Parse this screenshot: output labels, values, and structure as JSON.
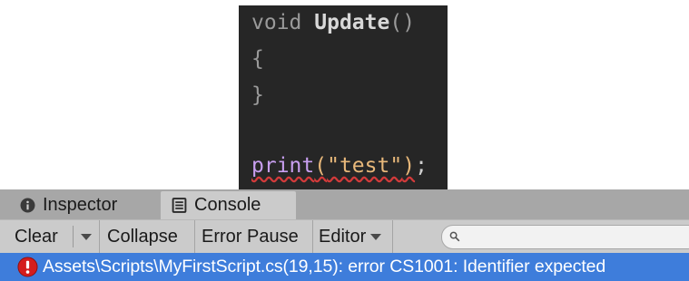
{
  "code": {
    "line1": {
      "keyword": "void",
      "name": "Update",
      "parens": "()"
    },
    "line2": "{",
    "line3": "}",
    "line5": {
      "call": "print",
      "open": "(",
      "string": "\"test\"",
      "close": ")",
      "semi": ";"
    }
  },
  "tabs": [
    {
      "label": "Inspector",
      "icon": "info-icon"
    },
    {
      "label": "Console",
      "icon": "console-icon",
      "active": true
    }
  ],
  "toolbar": {
    "clear_label": "Clear",
    "collapse_label": "Collapse",
    "error_pause_label": "Error Pause",
    "editor_label": "Editor",
    "search_value": ""
  },
  "console": {
    "entries": [
      {
        "level": "error",
        "icon": "error-icon",
        "message": "Assets\\Scripts\\MyFirstScript.cs(19,15): error CS1001: Identifier expected"
      }
    ]
  },
  "colors": {
    "editor_bg": "#262626",
    "tab_strip": "#a7a7a7",
    "toolbar": "#cbcbcb",
    "selected_row": "#3e7ddb",
    "error_red": "#d41d1d"
  }
}
